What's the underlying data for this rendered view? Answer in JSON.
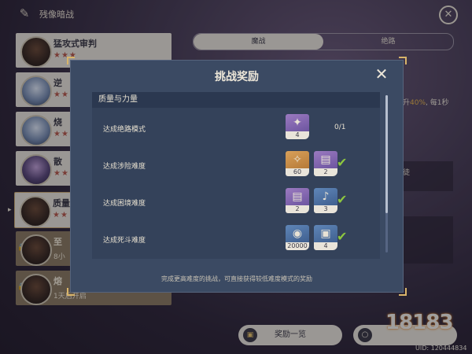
{
  "topbar": {
    "title": "残像暗战"
  },
  "challenges": [
    {
      "name": "猛攻式审判",
      "stars": "★★★",
      "avatar": "dark"
    },
    {
      "name": "逆",
      "stars": "★★",
      "avatar": "blue"
    },
    {
      "name": "烧",
      "stars": "★★★",
      "avatar": "blue"
    },
    {
      "name": "散",
      "stars": "★★★",
      "avatar": "purple"
    },
    {
      "name": "质量",
      "stars": "★★",
      "avatar": "dark"
    },
    {
      "name": "至",
      "sub": "8小",
      "avatar": "dark"
    },
    {
      "name": "熔",
      "sub": "1天后开启",
      "avatar": "dark"
    }
  ],
  "tabs": {
    "active": "魔战",
    "inactive": "绝路"
  },
  "background_fragments": {
    "buff_text_before": "升",
    "buff_percent": "40%",
    "buff_text_after": ", 每1秒",
    "side_glyph": "徒"
  },
  "buttons": {
    "reward_list": "奖励一览"
  },
  "watermark": "18183",
  "uid": "UID: 120444834",
  "modal": {
    "title": "挑战奖励",
    "section": "质量与力量",
    "rows": [
      {
        "label": "达成绝路模式",
        "items": [
          {
            "color": "purple",
            "glyph": "✦",
            "qty": "4"
          }
        ],
        "progress": "0/1"
      },
      {
        "label": "达成涉险难度",
        "items": [
          {
            "color": "orange",
            "glyph": "✧",
            "qty": "60"
          },
          {
            "color": "purple",
            "glyph": "▤",
            "qty": "2"
          }
        ],
        "done": true
      },
      {
        "label": "达成困境难度",
        "items": [
          {
            "color": "purple",
            "glyph": "▤",
            "qty": "2"
          },
          {
            "color": "blue",
            "glyph": "♪",
            "qty": "3"
          }
        ],
        "done": true
      },
      {
        "label": "达成死斗难度",
        "items": [
          {
            "color": "blue",
            "glyph": "◉",
            "qty": "20000"
          },
          {
            "color": "blue",
            "glyph": "▣",
            "qty": "4"
          }
        ],
        "done": true
      }
    ],
    "footnote": "完成更高难度的挑战，可直接获得较低难度模式的奖励"
  },
  "colors": {
    "modal_bg": "#3b4a63",
    "accent_gold": "#d8b46a",
    "check_green": "#8dc63f",
    "buff_accent": "#e9b54d"
  }
}
